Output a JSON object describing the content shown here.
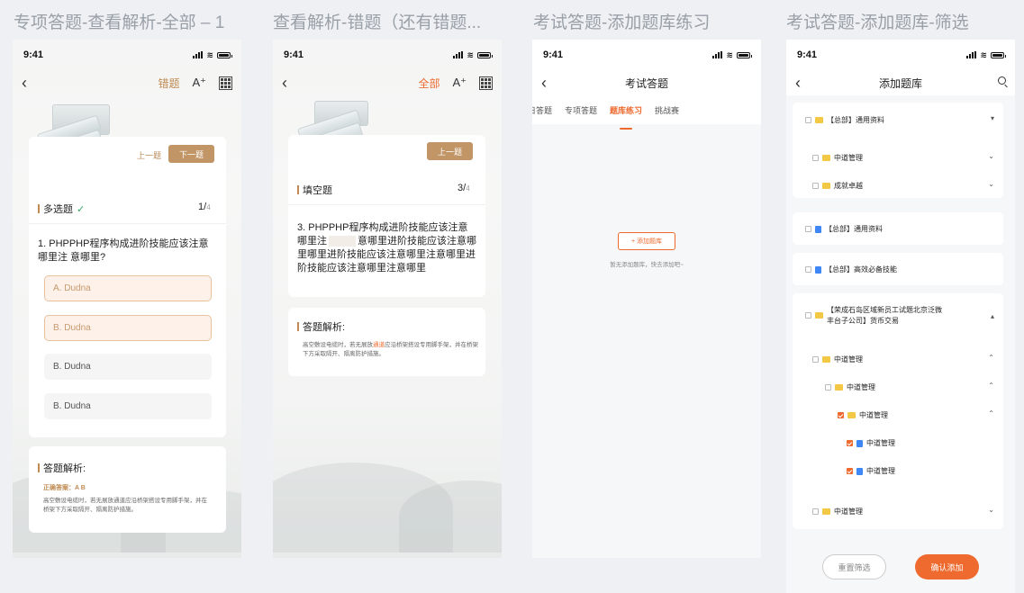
{
  "boards": [
    {
      "title": "专项答题-查看解析-全部 – 1"
    },
    {
      "title": "查看解析-错题（还有错题..."
    },
    {
      "title": "考试答题-添加题库练习"
    },
    {
      "title": "考试答题-添加题库-筛选"
    }
  ],
  "status": {
    "time": "9:41"
  },
  "screen1": {
    "nav_mode": "错题",
    "font_icon": "A⁺",
    "prev_label": "上一题",
    "next_label": "下一题",
    "qtype": "多选题",
    "counter_current": "1/",
    "counter_total": "4",
    "question": "1. PHPPHP程序构成进阶技能应该注意哪里注  意哪里?",
    "options": [
      "A. Dudna",
      "B. Dudna",
      "B. Dudna",
      "B. Dudna"
    ],
    "analysis_title": "答题解析:",
    "answer_text": "正确答案：A B",
    "analysis_text": "高空敷设电缆时，若无展放通道应沿桥架搭设专用脚手架，并在桥架下方采取隔开、隔离防护措施。"
  },
  "screen2": {
    "nav_mode": "全部",
    "font_icon": "A⁺",
    "prev_label": "上一题",
    "qtype": "填空题",
    "counter_current": "3/",
    "counter_total": "4",
    "question_a": "3. PHPPHP程序构成进阶技能应该注意哪里注",
    "question_blank": "",
    "question_b": "意哪里进阶技能应该注意哪里哪里进阶技能应该注意哪里注意哪里进阶技能应该注意哪里注意哪里",
    "analysis_title": "答题解析:",
    "analysis_pre": "高空敷设电缆时，若无展放",
    "analysis_hl": "通道",
    "analysis_post": "应沿桥架搭设专用脚手架，并在桥架下方采取隔开、隔离防护措施。"
  },
  "screen3": {
    "title": "考试答题",
    "tabs": [
      "每日答题",
      "专项答题",
      "题库练习",
      "挑战赛"
    ],
    "add_button": "+ 添加题库",
    "empty_text": "暂无添加题库，快去添加吧~"
  },
  "screen4": {
    "title": "添加题库",
    "rows": [
      {
        "label": "【总部】通用资料"
      },
      {
        "label": "中道管理"
      },
      {
        "label": "成就卓越"
      },
      {
        "label": "【总部】通用资料"
      },
      {
        "label": "【总部】高效必备技能"
      },
      {
        "label_line1": "【荣成石岛区域新员工试题北京泛微",
        "label_line2": "丰台子公司】货币交易"
      },
      {
        "label": "中道管理"
      },
      {
        "label": "中道管理"
      },
      {
        "label": "中道管理"
      },
      {
        "label": "中道管理"
      },
      {
        "label": "中道管理"
      },
      {
        "label": "中道管理"
      }
    ],
    "reset_button": "重置筛选",
    "confirm_button": "确认添加"
  },
  "colors": {
    "accent": "#c08a52",
    "brand_orange": "#ee6a2f",
    "folder": "#f3c845",
    "doc": "#3f87f5"
  }
}
